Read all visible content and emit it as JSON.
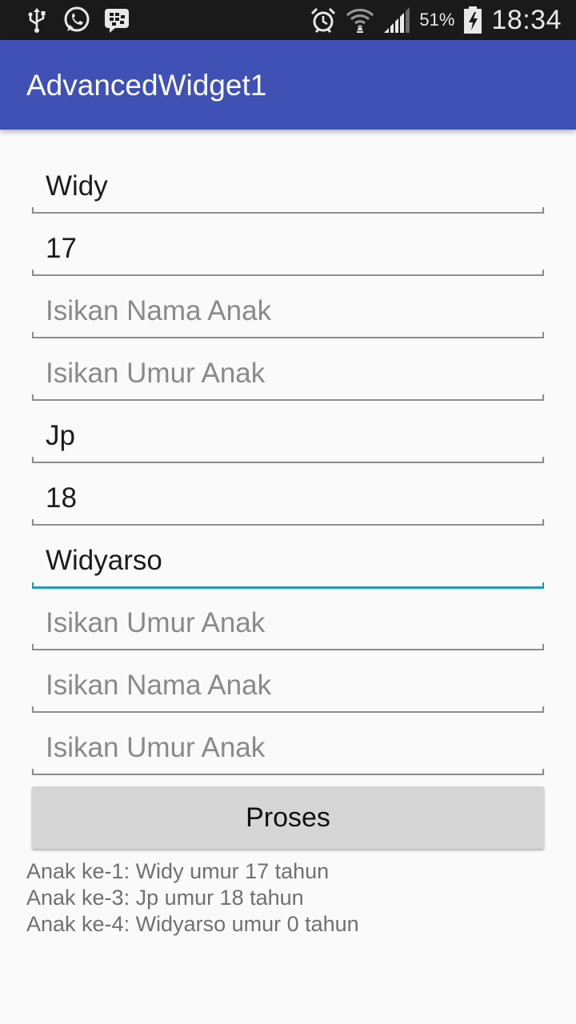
{
  "status_bar": {
    "battery_percent": "51%",
    "time": "18:34",
    "icons_left": [
      "usb-icon",
      "whatsapp-icon",
      "bbm-icon"
    ],
    "icons_right": [
      "alarm-icon",
      "wifi-icon",
      "signal-icon",
      "battery-icon"
    ]
  },
  "app_bar": {
    "title": "AdvancedWidget1"
  },
  "fields": [
    {
      "value": "Widy",
      "placeholder": "Isikan Nama Anak"
    },
    {
      "value": "17",
      "placeholder": "Isikan Umur Anak"
    },
    {
      "value": "",
      "placeholder": "Isikan Nama Anak"
    },
    {
      "value": "",
      "placeholder": "Isikan Umur Anak"
    },
    {
      "value": "Jp",
      "placeholder": "Isikan Nama Anak"
    },
    {
      "value": "18",
      "placeholder": "Isikan Umur Anak"
    },
    {
      "value": "Widyarso",
      "placeholder": "Isikan Nama Anak",
      "focused": true
    },
    {
      "value": "",
      "placeholder": "Isikan Umur Anak"
    },
    {
      "value": "",
      "placeholder": "Isikan Nama Anak"
    },
    {
      "value": "",
      "placeholder": "Isikan Umur Anak"
    }
  ],
  "button": {
    "label": "Proses"
  },
  "result_lines": [
    "Anak ke-1: Widy umur 17 tahun",
    "Anak ke-3: Jp umur 18 tahun",
    "Anak ke-4: Widyarso umur 0 tahun"
  ],
  "colors": {
    "app_bar": "#3f51b5",
    "status_bar": "#1a1a1a",
    "focus_accent": "#1e9bb0",
    "button": "#d6d6d6"
  }
}
